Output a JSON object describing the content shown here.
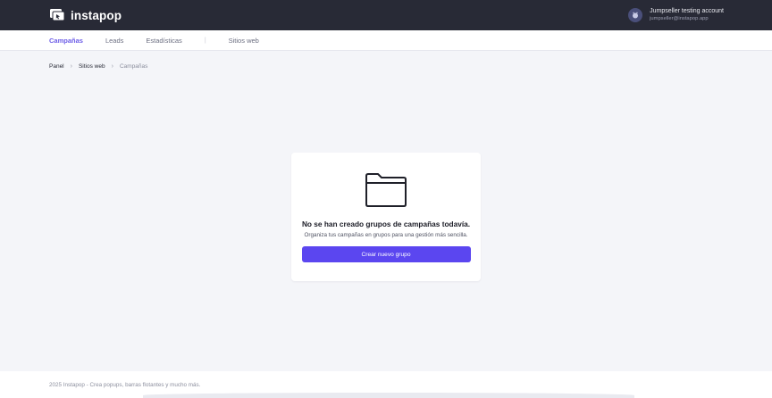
{
  "header": {
    "brand_name": "instapop",
    "account_name": "Jumpseller testing account",
    "account_email": "jumpseller@instapop.app"
  },
  "nav": {
    "items": [
      {
        "label": "Campañas",
        "active": true
      },
      {
        "label": "Leads",
        "active": false
      },
      {
        "label": "Estadísticas",
        "active": false
      },
      {
        "label": "Sitios web",
        "active": false
      }
    ],
    "separator": "|"
  },
  "breadcrumb": {
    "items": [
      "Panel",
      "Sitios web",
      "Campañas"
    ],
    "separator": "›"
  },
  "empty_state": {
    "icon": "folder-icon",
    "title": "No se han creado grupos de campañas todavía.",
    "subtitle": "Organiza tus campañas en grupos para una gestión más sencilla.",
    "button_label": "Crear nuevo grupo"
  },
  "footer": {
    "text": "2025 Instapop - Crea popups, barras flotantes y mucho más."
  },
  "colors": {
    "accent": "#5b46f0",
    "nav_active": "#6c5ce7",
    "topbar": "#282a36",
    "background": "#f4f5f9"
  }
}
